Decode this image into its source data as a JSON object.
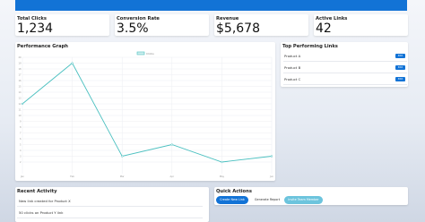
{
  "stats": [
    {
      "title": "Total Clicks",
      "value": "1,234"
    },
    {
      "title": "Conversion Rate",
      "value": "3.5%"
    },
    {
      "title": "Revenue",
      "value": "$5,678"
    },
    {
      "title": "Active Links",
      "value": "42"
    }
  ],
  "performance": {
    "title": "Performance Graph",
    "legend": "Clicks",
    "series_color": "#4bc0c0"
  },
  "top_links": {
    "title": "Top Performing Links",
    "items": [
      {
        "label": "Product A",
        "button": "Edit"
      },
      {
        "label": "Product B",
        "button": "Edit"
      },
      {
        "label": "Product C",
        "button": "Edit"
      }
    ]
  },
  "recent_activity": {
    "title": "Recent Activity",
    "items": [
      "New link created for Product X",
      "50 clicks on Product Y link"
    ]
  },
  "quick_actions": {
    "title": "Quick Actions",
    "buttons": [
      "Create New Link",
      "Generate Report",
      "Invite Team Member"
    ]
  },
  "chart_data": {
    "type": "line",
    "categories": [
      "Jan",
      "Feb",
      "Mar",
      "Apr",
      "May",
      "Jun"
    ],
    "series": [
      {
        "name": "Clicks",
        "values": [
          12,
          19,
          3,
          5,
          2,
          3
        ]
      }
    ],
    "y_ticks": [
      "20",
      "19",
      "18",
      "17",
      "16",
      "15",
      "14",
      "13",
      "12",
      "11",
      "10",
      "9",
      "8",
      "7",
      "6",
      "5",
      "4",
      "3",
      "2"
    ],
    "ylim": [
      0,
      20
    ],
    "grid": true,
    "legend_position": "top"
  }
}
